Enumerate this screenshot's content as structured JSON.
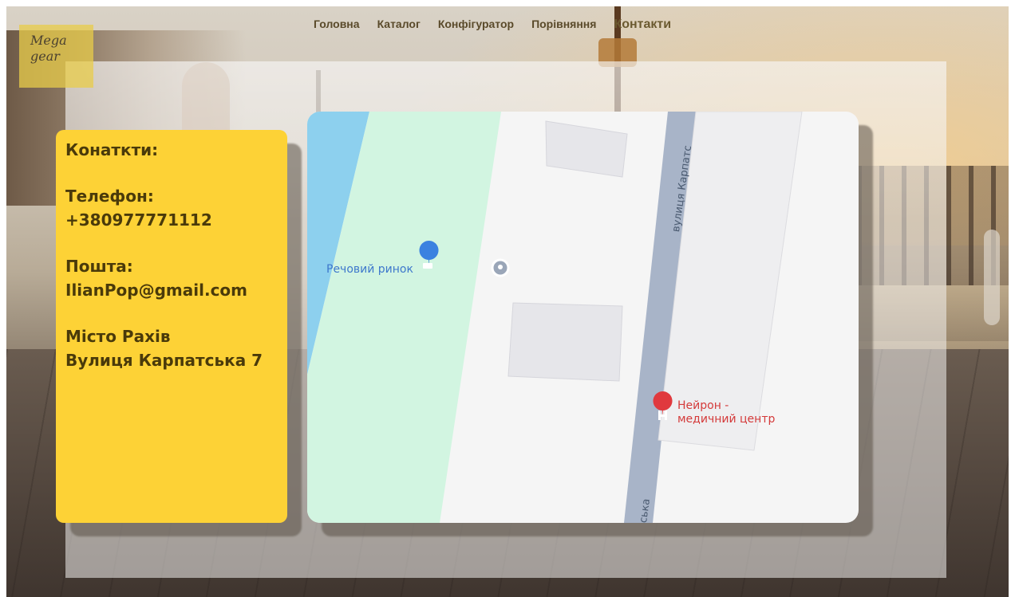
{
  "logo": {
    "line1": "Mega",
    "line2": "gear"
  },
  "nav": {
    "items": [
      {
        "label": "Головна"
      },
      {
        "label": "Каталог"
      },
      {
        "label": "Конфігуратор"
      },
      {
        "label": "Порівняння"
      },
      {
        "label": "Контакти",
        "active": true
      }
    ]
  },
  "contacts": {
    "heading": "Конаткти:",
    "phone_label": "Телефон:",
    "phone_value": "+380977771112",
    "email_label": "Пошта:",
    "email_value": "IlianPop@gmail.com",
    "city": "Місто Рахів",
    "street": "Вулиця Карпатська 7"
  },
  "map": {
    "market_label": "Речовий ринок",
    "market_icon": "shopping-cart-icon",
    "poi_icon": "map-pin-icon",
    "clinic_label_line1": "Нейрон -",
    "clinic_label_line2": "медичний центр",
    "clinic_icon": "hospital-icon",
    "street_label_top": "вулиця Карпатс",
    "street_label_bottom": "ська",
    "colors": {
      "water": "#8dd0ee",
      "park": "#d2f5e1",
      "road": "#a8b4c8",
      "building": "#e6e6ea",
      "market_pin": "#3b82e0",
      "clinic_pin": "#e0393e"
    }
  },
  "colors": {
    "accent_yellow": "#fdd236",
    "logo_bg": "#e8cc4a",
    "text_dark": "#4a3a0a"
  }
}
